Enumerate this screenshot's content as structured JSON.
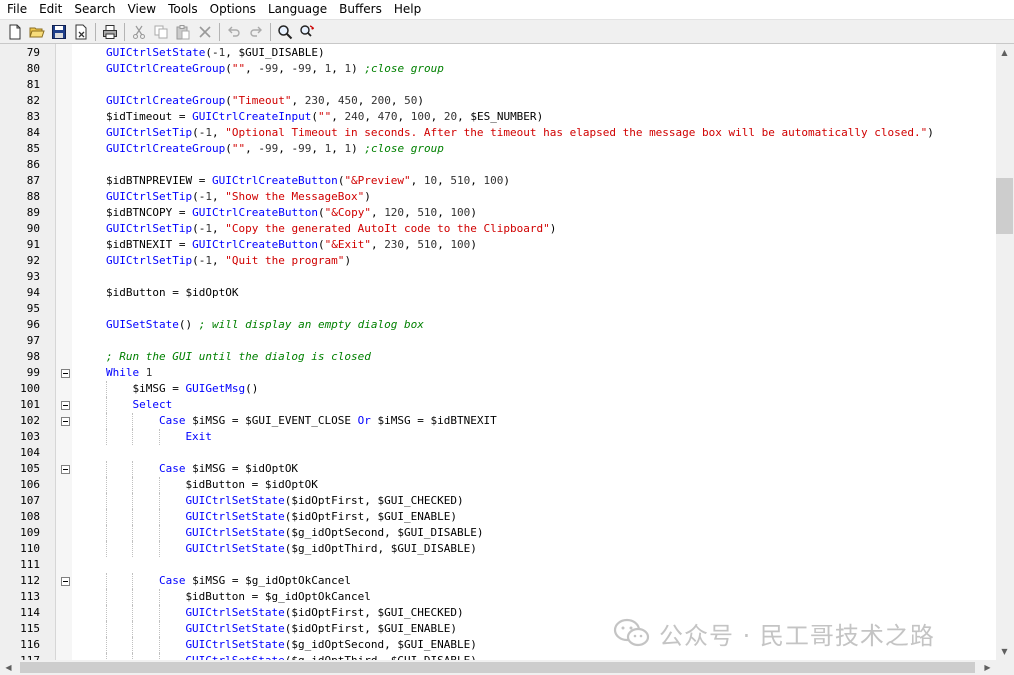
{
  "menu": [
    "File",
    "Edit",
    "Search",
    "View",
    "Tools",
    "Options",
    "Language",
    "Buffers",
    "Help"
  ],
  "toolbar": {
    "icons": [
      "new-file-icon",
      "open-folder-icon",
      "save-icon",
      "close-file-icon",
      "print-icon",
      "cut-icon",
      "copy-icon",
      "paste-icon",
      "delete-icon",
      "undo-icon",
      "redo-icon",
      "find-icon",
      "replace-icon"
    ]
  },
  "editor": {
    "lines": [
      {
        "n": "79",
        "fold": false,
        "indent": 0,
        "tokens": [
          [
            "fn",
            "GUICtrlSetState"
          ],
          [
            "op",
            "(-"
          ],
          [
            "num",
            "1"
          ],
          [
            "op",
            ", "
          ],
          [
            "mac",
            "$GUI_DISABLE"
          ],
          [
            "op",
            ")"
          ]
        ]
      },
      {
        "n": "80",
        "fold": false,
        "indent": 0,
        "tokens": [
          [
            "fn",
            "GUICtrlCreateGroup"
          ],
          [
            "op",
            "("
          ],
          [
            "str",
            "\"\""
          ],
          [
            "op",
            ", -"
          ],
          [
            "num",
            "99"
          ],
          [
            "op",
            ", -"
          ],
          [
            "num",
            "99"
          ],
          [
            "op",
            ", "
          ],
          [
            "num",
            "1"
          ],
          [
            "op",
            ", "
          ],
          [
            "num",
            "1"
          ],
          [
            "op",
            ") "
          ],
          [
            "cmt",
            ";close group"
          ]
        ]
      },
      {
        "n": "81",
        "fold": false,
        "indent": 0,
        "tokens": []
      },
      {
        "n": "82",
        "fold": false,
        "indent": 0,
        "tokens": [
          [
            "fn",
            "GUICtrlCreateGroup"
          ],
          [
            "op",
            "("
          ],
          [
            "str",
            "\"Timeout\""
          ],
          [
            "op",
            ", "
          ],
          [
            "num",
            "230"
          ],
          [
            "op",
            ", "
          ],
          [
            "num",
            "450"
          ],
          [
            "op",
            ", "
          ],
          [
            "num",
            "200"
          ],
          [
            "op",
            ", "
          ],
          [
            "num",
            "50"
          ],
          [
            "op",
            ")"
          ]
        ]
      },
      {
        "n": "83",
        "fold": false,
        "indent": 0,
        "tokens": [
          [
            "var",
            "$idTimeout"
          ],
          [
            "op",
            " = "
          ],
          [
            "fn",
            "GUICtrlCreateInput"
          ],
          [
            "op",
            "("
          ],
          [
            "str",
            "\"\""
          ],
          [
            "op",
            ", "
          ],
          [
            "num",
            "240"
          ],
          [
            "op",
            ", "
          ],
          [
            "num",
            "470"
          ],
          [
            "op",
            ", "
          ],
          [
            "num",
            "100"
          ],
          [
            "op",
            ", "
          ],
          [
            "num",
            "20"
          ],
          [
            "op",
            ", "
          ],
          [
            "mac",
            "$ES_NUMBER"
          ],
          [
            "op",
            ")"
          ]
        ]
      },
      {
        "n": "84",
        "fold": false,
        "indent": 0,
        "tokens": [
          [
            "fn",
            "GUICtrlSetTip"
          ],
          [
            "op",
            "(-"
          ],
          [
            "num",
            "1"
          ],
          [
            "op",
            ", "
          ],
          [
            "str",
            "\"Optional Timeout in seconds. After the timeout has elapsed the message box will be automatically closed.\""
          ],
          [
            "op",
            ")"
          ]
        ]
      },
      {
        "n": "85",
        "fold": false,
        "indent": 0,
        "tokens": [
          [
            "fn",
            "GUICtrlCreateGroup"
          ],
          [
            "op",
            "("
          ],
          [
            "str",
            "\"\""
          ],
          [
            "op",
            ", -"
          ],
          [
            "num",
            "99"
          ],
          [
            "op",
            ", -"
          ],
          [
            "num",
            "99"
          ],
          [
            "op",
            ", "
          ],
          [
            "num",
            "1"
          ],
          [
            "op",
            ", "
          ],
          [
            "num",
            "1"
          ],
          [
            "op",
            ") "
          ],
          [
            "cmt",
            ";close group"
          ]
        ]
      },
      {
        "n": "86",
        "fold": false,
        "indent": 0,
        "tokens": []
      },
      {
        "n": "87",
        "fold": false,
        "indent": 0,
        "tokens": [
          [
            "var",
            "$idBTNPREVIEW"
          ],
          [
            "op",
            " = "
          ],
          [
            "fn",
            "GUICtrlCreateButton"
          ],
          [
            "op",
            "("
          ],
          [
            "str",
            "\"&Preview\""
          ],
          [
            "op",
            ", "
          ],
          [
            "num",
            "10"
          ],
          [
            "op",
            ", "
          ],
          [
            "num",
            "510"
          ],
          [
            "op",
            ", "
          ],
          [
            "num",
            "100"
          ],
          [
            "op",
            ")"
          ]
        ]
      },
      {
        "n": "88",
        "fold": false,
        "indent": 0,
        "tokens": [
          [
            "fn",
            "GUICtrlSetTip"
          ],
          [
            "op",
            "(-"
          ],
          [
            "num",
            "1"
          ],
          [
            "op",
            ", "
          ],
          [
            "str",
            "\"Show the MessageBox\""
          ],
          [
            "op",
            ")"
          ]
        ]
      },
      {
        "n": "89",
        "fold": false,
        "indent": 0,
        "tokens": [
          [
            "var",
            "$idBTNCOPY"
          ],
          [
            "op",
            " = "
          ],
          [
            "fn",
            "GUICtrlCreateButton"
          ],
          [
            "op",
            "("
          ],
          [
            "str",
            "\"&Copy\""
          ],
          [
            "op",
            ", "
          ],
          [
            "num",
            "120"
          ],
          [
            "op",
            ", "
          ],
          [
            "num",
            "510"
          ],
          [
            "op",
            ", "
          ],
          [
            "num",
            "100"
          ],
          [
            "op",
            ")"
          ]
        ]
      },
      {
        "n": "90",
        "fold": false,
        "indent": 0,
        "tokens": [
          [
            "fn",
            "GUICtrlSetTip"
          ],
          [
            "op",
            "(-"
          ],
          [
            "num",
            "1"
          ],
          [
            "op",
            ", "
          ],
          [
            "str",
            "\"Copy the generated AutoIt code to the Clipboard\""
          ],
          [
            "op",
            ")"
          ]
        ]
      },
      {
        "n": "91",
        "fold": false,
        "indent": 0,
        "tokens": [
          [
            "var",
            "$idBTNEXIT"
          ],
          [
            "op",
            " = "
          ],
          [
            "fn",
            "GUICtrlCreateButton"
          ],
          [
            "op",
            "("
          ],
          [
            "str",
            "\"&Exit\""
          ],
          [
            "op",
            ", "
          ],
          [
            "num",
            "230"
          ],
          [
            "op",
            ", "
          ],
          [
            "num",
            "510"
          ],
          [
            "op",
            ", "
          ],
          [
            "num",
            "100"
          ],
          [
            "op",
            ")"
          ]
        ]
      },
      {
        "n": "92",
        "fold": false,
        "indent": 0,
        "tokens": [
          [
            "fn",
            "GUICtrlSetTip"
          ],
          [
            "op",
            "(-"
          ],
          [
            "num",
            "1"
          ],
          [
            "op",
            ", "
          ],
          [
            "str",
            "\"Quit the program\""
          ],
          [
            "op",
            ")"
          ]
        ]
      },
      {
        "n": "93",
        "fold": false,
        "indent": 0,
        "tokens": []
      },
      {
        "n": "94",
        "fold": false,
        "indent": 0,
        "tokens": [
          [
            "var",
            "$idButton"
          ],
          [
            "op",
            " = "
          ],
          [
            "var",
            "$idOptOK"
          ]
        ]
      },
      {
        "n": "95",
        "fold": false,
        "indent": 0,
        "tokens": []
      },
      {
        "n": "96",
        "fold": false,
        "indent": 0,
        "tokens": [
          [
            "fn",
            "GUISetState"
          ],
          [
            "op",
            "() "
          ],
          [
            "cmt",
            "; will display an empty dialog box"
          ]
        ]
      },
      {
        "n": "97",
        "fold": false,
        "indent": 0,
        "tokens": []
      },
      {
        "n": "98",
        "fold": false,
        "indent": 0,
        "tokens": [
          [
            "cmt",
            "; Run the GUI until the dialog is closed"
          ]
        ]
      },
      {
        "n": "99",
        "fold": true,
        "indent": 0,
        "tokens": [
          [
            "kw",
            "While"
          ],
          [
            "op",
            " "
          ],
          [
            "num",
            "1"
          ]
        ]
      },
      {
        "n": "100",
        "fold": false,
        "indent": 1,
        "tokens": [
          [
            "var",
            "$iMSG"
          ],
          [
            "op",
            " = "
          ],
          [
            "fn",
            "GUIGetMsg"
          ],
          [
            "op",
            "()"
          ]
        ]
      },
      {
        "n": "101",
        "fold": true,
        "indent": 1,
        "tokens": [
          [
            "kw",
            "Select"
          ]
        ]
      },
      {
        "n": "102",
        "fold": true,
        "indent": 2,
        "tokens": [
          [
            "kw",
            "Case"
          ],
          [
            "op",
            " "
          ],
          [
            "var",
            "$iMSG"
          ],
          [
            "op",
            " = "
          ],
          [
            "mac",
            "$GUI_EVENT_CLOSE"
          ],
          [
            "op",
            " "
          ],
          [
            "kw",
            "Or"
          ],
          [
            "op",
            " "
          ],
          [
            "var",
            "$iMSG"
          ],
          [
            "op",
            " = "
          ],
          [
            "var",
            "$idBTNEXIT"
          ]
        ]
      },
      {
        "n": "103",
        "fold": false,
        "indent": 3,
        "tokens": [
          [
            "kw",
            "Exit"
          ]
        ]
      },
      {
        "n": "104",
        "fold": false,
        "indent": 0,
        "tokens": []
      },
      {
        "n": "105",
        "fold": true,
        "indent": 2,
        "tokens": [
          [
            "kw",
            "Case"
          ],
          [
            "op",
            " "
          ],
          [
            "var",
            "$iMSG"
          ],
          [
            "op",
            " = "
          ],
          [
            "var",
            "$idOptOK"
          ]
        ]
      },
      {
        "n": "106",
        "fold": false,
        "indent": 3,
        "tokens": [
          [
            "var",
            "$idButton"
          ],
          [
            "op",
            " = "
          ],
          [
            "var",
            "$idOptOK"
          ]
        ]
      },
      {
        "n": "107",
        "fold": false,
        "indent": 3,
        "tokens": [
          [
            "fn",
            "GUICtrlSetState"
          ],
          [
            "op",
            "("
          ],
          [
            "var",
            "$idOptFirst"
          ],
          [
            "op",
            ", "
          ],
          [
            "mac",
            "$GUI_CHECKED"
          ],
          [
            "op",
            ")"
          ]
        ]
      },
      {
        "n": "108",
        "fold": false,
        "indent": 3,
        "tokens": [
          [
            "fn",
            "GUICtrlSetState"
          ],
          [
            "op",
            "("
          ],
          [
            "var",
            "$idOptFirst"
          ],
          [
            "op",
            ", "
          ],
          [
            "mac",
            "$GUI_ENABLE"
          ],
          [
            "op",
            ")"
          ]
        ]
      },
      {
        "n": "109",
        "fold": false,
        "indent": 3,
        "tokens": [
          [
            "fn",
            "GUICtrlSetState"
          ],
          [
            "op",
            "("
          ],
          [
            "var",
            "$g_idOptSecond"
          ],
          [
            "op",
            ", "
          ],
          [
            "mac",
            "$GUI_DISABLE"
          ],
          [
            "op",
            ")"
          ]
        ]
      },
      {
        "n": "110",
        "fold": false,
        "indent": 3,
        "tokens": [
          [
            "fn",
            "GUICtrlSetState"
          ],
          [
            "op",
            "("
          ],
          [
            "var",
            "$g_idOptThird"
          ],
          [
            "op",
            ", "
          ],
          [
            "mac",
            "$GUI_DISABLE"
          ],
          [
            "op",
            ")"
          ]
        ]
      },
      {
        "n": "111",
        "fold": false,
        "indent": 0,
        "tokens": []
      },
      {
        "n": "112",
        "fold": true,
        "indent": 2,
        "tokens": [
          [
            "kw",
            "Case"
          ],
          [
            "op",
            " "
          ],
          [
            "var",
            "$iMSG"
          ],
          [
            "op",
            " = "
          ],
          [
            "var",
            "$g_idOptOkCancel"
          ]
        ]
      },
      {
        "n": "113",
        "fold": false,
        "indent": 3,
        "tokens": [
          [
            "var",
            "$idButton"
          ],
          [
            "op",
            " = "
          ],
          [
            "var",
            "$g_idOptOkCancel"
          ]
        ]
      },
      {
        "n": "114",
        "fold": false,
        "indent": 3,
        "tokens": [
          [
            "fn",
            "GUICtrlSetState"
          ],
          [
            "op",
            "("
          ],
          [
            "var",
            "$idOptFirst"
          ],
          [
            "op",
            ", "
          ],
          [
            "mac",
            "$GUI_CHECKED"
          ],
          [
            "op",
            ")"
          ]
        ]
      },
      {
        "n": "115",
        "fold": false,
        "indent": 3,
        "tokens": [
          [
            "fn",
            "GUICtrlSetState"
          ],
          [
            "op",
            "("
          ],
          [
            "var",
            "$idOptFirst"
          ],
          [
            "op",
            ", "
          ],
          [
            "mac",
            "$GUI_ENABLE"
          ],
          [
            "op",
            ")"
          ]
        ]
      },
      {
        "n": "116",
        "fold": false,
        "indent": 3,
        "tokens": [
          [
            "fn",
            "GUICtrlSetState"
          ],
          [
            "op",
            "("
          ],
          [
            "var",
            "$g_idOptSecond"
          ],
          [
            "op",
            ", "
          ],
          [
            "mac",
            "$GUI_ENABLE"
          ],
          [
            "op",
            ")"
          ]
        ]
      },
      {
        "n": "117",
        "fold": false,
        "indent": 3,
        "tokens": [
          [
            "fn",
            "GUICtrlSetState"
          ],
          [
            "op",
            "("
          ],
          [
            "var",
            "$g_idOptThird"
          ],
          [
            "op",
            ", "
          ],
          [
            "mac",
            "$GUI_DISABLE"
          ],
          [
            "op",
            ")"
          ]
        ]
      }
    ]
  },
  "watermark": {
    "text": "公众号 · 民工哥技术之路"
  },
  "colors": {
    "keyword": "#0000ff",
    "string": "#d00000",
    "comment": "#008000",
    "gutter": "#efefef"
  }
}
